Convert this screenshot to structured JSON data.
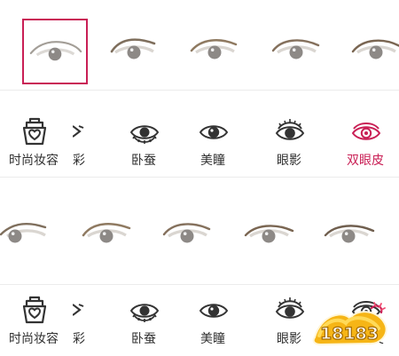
{
  "top_panel": {
    "tabs": [
      {
        "label": "时尚妆容",
        "icon": "makeup-kit-icon",
        "active": false
      },
      {
        "label": "卧蚕",
        "icon": "eye-bag-icon",
        "active": false
      },
      {
        "label": "美瞳",
        "icon": "eye-icon",
        "active": false
      },
      {
        "label": "眼影",
        "icon": "eye-shadow-icon",
        "active": false
      },
      {
        "label": "双眼皮",
        "icon": "double-eyelid-icon",
        "active": true
      }
    ]
  },
  "bottom_panel": {
    "tabs": [
      {
        "label": "时尚妆容",
        "icon": "makeup-kit-icon",
        "active": false
      },
      {
        "label": "卧蚕",
        "icon": "eye-bag-icon",
        "active": false
      },
      {
        "label": "美瞳",
        "icon": "eye-icon",
        "active": false
      },
      {
        "label": "眼影",
        "icon": "eye-shadow-icon",
        "active": false
      },
      {
        "label": "双眼皮",
        "icon": "double-eyelid-icon",
        "active": false
      }
    ],
    "watermark": {
      "text": "18183"
    }
  },
  "colors": {
    "accent": "#c91f55",
    "text": "#2f2f2f",
    "divider": "#ececec"
  }
}
